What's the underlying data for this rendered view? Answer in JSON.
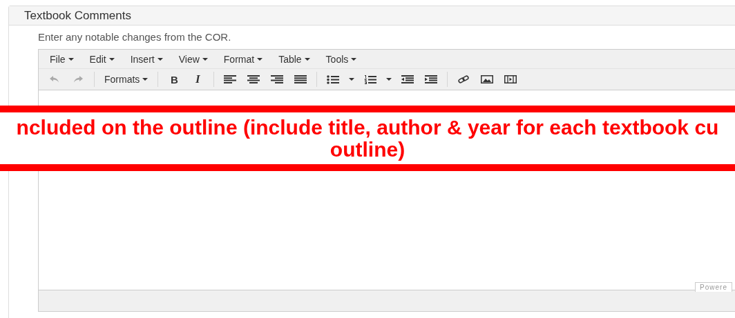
{
  "panel": {
    "title": "Textbook Comments",
    "description": "Enter any notable changes from the COR."
  },
  "editor": {
    "menus": [
      {
        "label": "File"
      },
      {
        "label": "Edit"
      },
      {
        "label": "Insert"
      },
      {
        "label": "View"
      },
      {
        "label": "Format"
      },
      {
        "label": "Table"
      },
      {
        "label": "Tools"
      }
    ],
    "formats_label": "Formats",
    "bold_label": "B",
    "italic_label": "I",
    "branding": "Powere"
  },
  "banner": {
    "lines": [
      "ncluded on the outline (include title, author & year for each textbook cu",
      "outline)"
    ]
  }
}
